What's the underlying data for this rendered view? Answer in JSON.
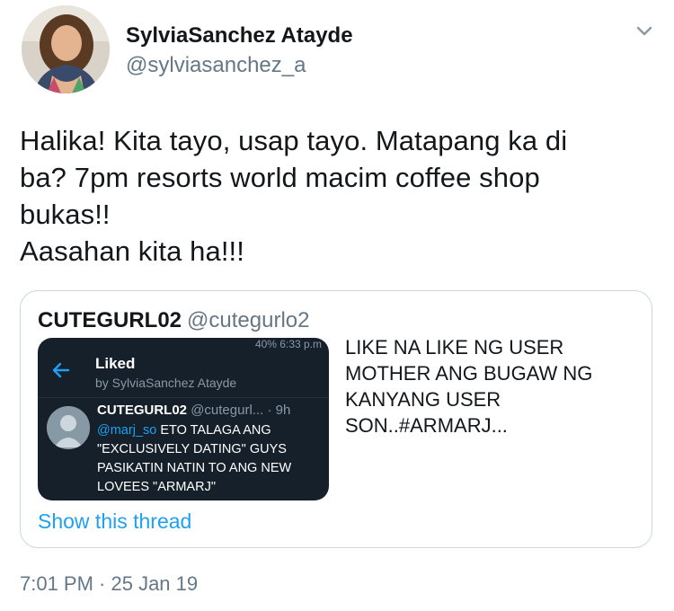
{
  "author": {
    "display_name": "SylviaSanchez Atayde",
    "handle": "@sylviasanchez_a"
  },
  "tweet": {
    "text": "Halika! Kita tayo, usap tayo. Matapang ka di\nba? 7pm resorts world macim coffee shop\nbukas!!\nAasahan kita ha!!!",
    "timestamp": "7:01 PM · 25 Jan 19"
  },
  "quoted_tweet": {
    "display_name": "CUTEGURL02",
    "handle": "@cutegurlo2",
    "text": "LIKE NA LIKE NG USER\nMOTHER ANG BUGAW NG\nKANYANG USER\nSON..#ARMARJ...",
    "show_thread": "Show this thread",
    "screenshot": {
      "status": "40%  6:33 p.m",
      "title": "Liked",
      "subtitle": "by SylviaSanchez Atayde",
      "inner_name": "CUTEGURL02",
      "inner_handle": "@cutegurl...",
      "inner_time": "· 9h",
      "inner_mention": "@marj_so",
      "inner_text": " ETO TALAGA ANG\n\"EXCLUSIVELY DATING\" GUYS\nPASIKATIN NATIN TO ANG NEW\nLOVEES \"ARMARJ\""
    }
  },
  "icons": {
    "caret": "chevron-down-icon",
    "back": "arrow-left-icon"
  },
  "colors": {
    "link": "#1da1f2",
    "secondary_text": "#657786",
    "border": "#ccd6dd",
    "dark_bg": "#15202b"
  }
}
